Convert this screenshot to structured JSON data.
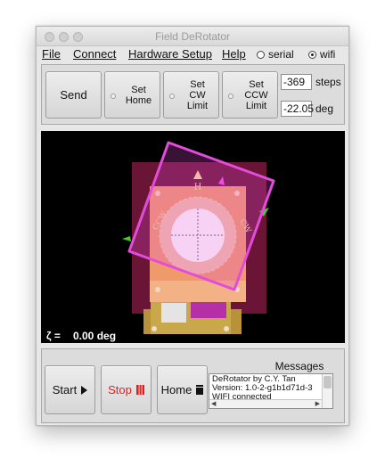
{
  "window": {
    "title": "Field DeRotator"
  },
  "menu": {
    "file": "File",
    "connect": "Connect",
    "hardware_setup": "Hardware Setup",
    "help": "Help",
    "serial": "serial",
    "wifi": "wifi",
    "selected_mode": "wifi"
  },
  "controls": {
    "send": "Send",
    "set_home": "Set\nHome",
    "set_cw": "Set\nCW\nLimit",
    "set_ccw": "Set\nCCW\nLimit",
    "steps_value": "-369",
    "steps_unit": "steps",
    "deg_value": "-22.05",
    "deg_unit": "deg"
  },
  "view": {
    "zeta_label": "ζ =",
    "zeta_value": "0.00 deg",
    "marker_home": "H",
    "marker_cw": "CW",
    "marker_ccw": "CCW"
  },
  "bottom": {
    "start": "Start",
    "stop": "Stop",
    "home": "Home",
    "messages_title": "Messages",
    "messages": [
      "DeRotator by C.Y. Tan",
      "Version: 1.0-2-g1b1d71d-3",
      "WIFI connected"
    ]
  },
  "colors": {
    "stop_text": "#e02020",
    "outer_board": "#6a1536",
    "rotator_frame": "#e24cd8",
    "disk": "#f39a72",
    "annulus": "#f2c2a6",
    "gold_plate": "#b79239",
    "home_marker": "#f1dfa0",
    "cw_marker": "#49c92f",
    "wifi_marker": "#ef4df0"
  }
}
